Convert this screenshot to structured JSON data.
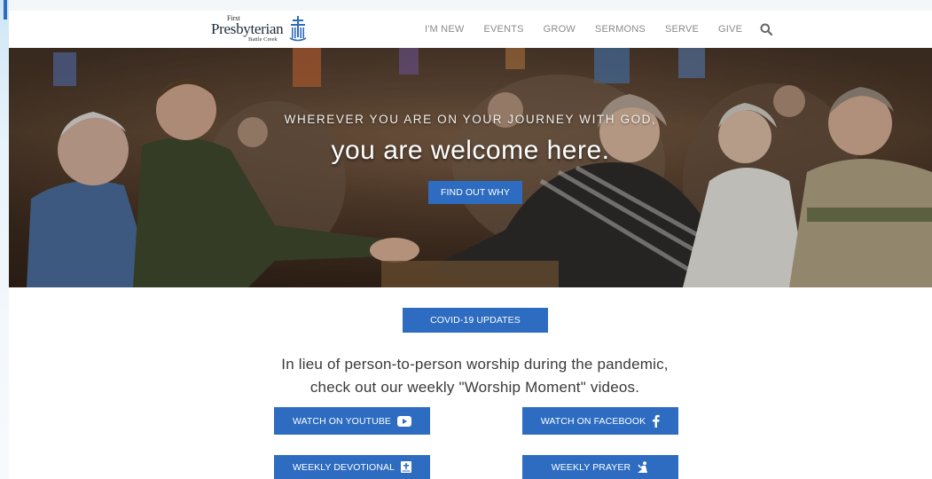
{
  "brand": {
    "logo_lines": [
      "First",
      "Presbyterian",
      "Battle Creek"
    ],
    "accent_color": "#2d6cc0"
  },
  "nav": {
    "items": [
      "I'M NEW",
      "EVENTS",
      "GROW",
      "SERMONS",
      "SERVE",
      "GIVE"
    ],
    "search_icon": "search-icon"
  },
  "hero": {
    "kicker": "WHEREVER YOU ARE ON YOUR JOURNEY WITH GOD,",
    "title": "you are welcome here.",
    "cta_label": "FIND OUT WHY"
  },
  "main": {
    "covid_label": "COVID-19 UPDATES",
    "lead_line1": "In lieu of person-to-person worship during the pandemic,",
    "lead_line2": "check out our weekly \"Worship Moment\" videos.",
    "buttons": {
      "youtube": {
        "label": "WATCH ON YOUTUBE",
        "icon": "youtube-icon"
      },
      "facebook": {
        "label": "WATCH ON FACEBOOK",
        "icon": "facebook-icon"
      },
      "devotional": {
        "label": "WEEKLY DEVOTIONAL",
        "icon": "bible-icon"
      },
      "prayer": {
        "label": "WEEKLY PRAYER",
        "icon": "praying-icon"
      }
    }
  }
}
